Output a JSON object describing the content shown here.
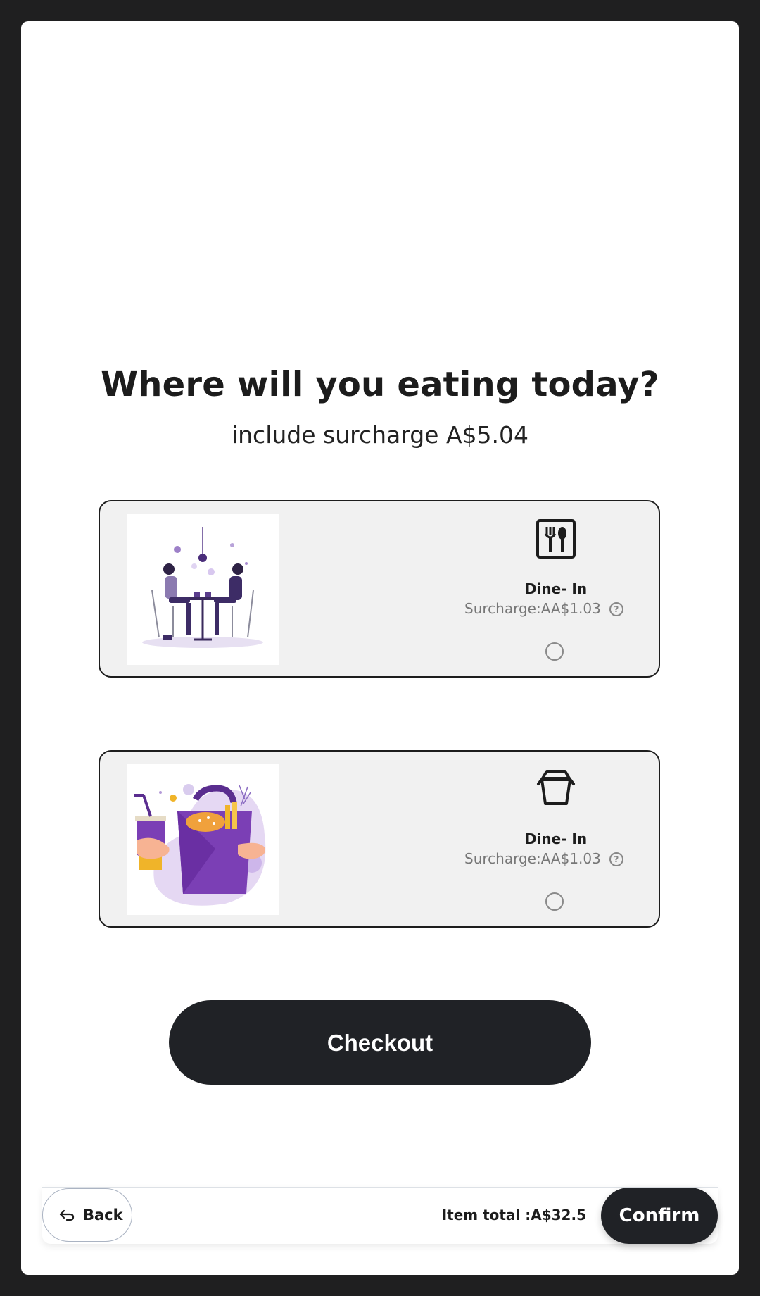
{
  "header": {
    "title": "Where will you eating today?",
    "subtitle": "include surcharge A$5.04"
  },
  "options": [
    {
      "label": "Dine- In",
      "surcharge": "Surcharge:AA$1.03",
      "icon": "cutlery-icon",
      "image": "dine-in-couple-illustration",
      "selected": false
    },
    {
      "label": "Dine- In",
      "surcharge": "Surcharge:AA$1.03",
      "icon": "takeaway-box-icon",
      "image": "takeaway-bag-illustration",
      "selected": false
    }
  ],
  "checkout_label": "Checkout",
  "footer": {
    "back_label": "Back",
    "item_total": "Item total :A$32.5",
    "confirm_label": "Confirm"
  },
  "colors": {
    "dark_button": "#202226",
    "card_bg": "#f1f1f1",
    "accent_purple": "#7b3fb5",
    "frame": "#1f1f20"
  }
}
